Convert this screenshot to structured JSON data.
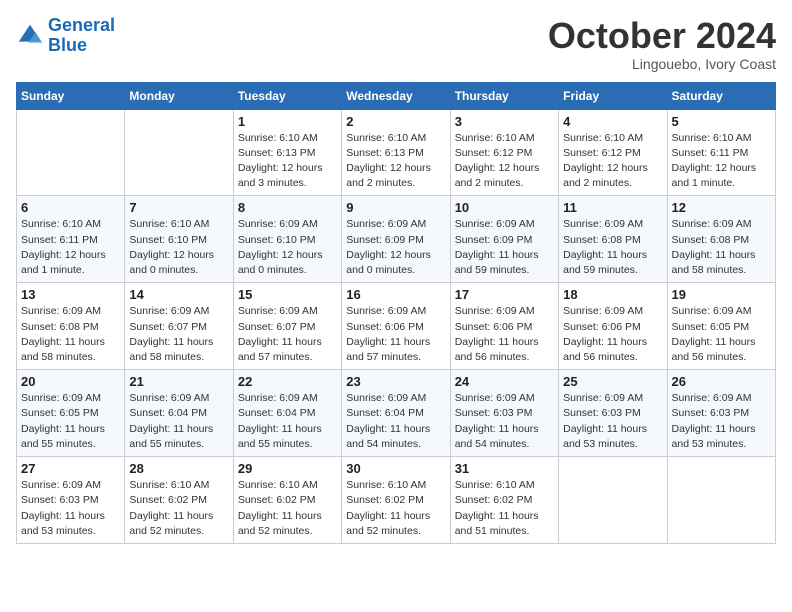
{
  "header": {
    "logo_line1": "General",
    "logo_line2": "Blue",
    "month": "October 2024",
    "location": "Lingouebo, Ivory Coast"
  },
  "weekdays": [
    "Sunday",
    "Monday",
    "Tuesday",
    "Wednesday",
    "Thursday",
    "Friday",
    "Saturday"
  ],
  "weeks": [
    [
      {
        "day": "",
        "info": ""
      },
      {
        "day": "",
        "info": ""
      },
      {
        "day": "1",
        "info": "Sunrise: 6:10 AM\nSunset: 6:13 PM\nDaylight: 12 hours and 3 minutes."
      },
      {
        "day": "2",
        "info": "Sunrise: 6:10 AM\nSunset: 6:13 PM\nDaylight: 12 hours and 2 minutes."
      },
      {
        "day": "3",
        "info": "Sunrise: 6:10 AM\nSunset: 6:12 PM\nDaylight: 12 hours and 2 minutes."
      },
      {
        "day": "4",
        "info": "Sunrise: 6:10 AM\nSunset: 6:12 PM\nDaylight: 12 hours and 2 minutes."
      },
      {
        "day": "5",
        "info": "Sunrise: 6:10 AM\nSunset: 6:11 PM\nDaylight: 12 hours and 1 minute."
      }
    ],
    [
      {
        "day": "6",
        "info": "Sunrise: 6:10 AM\nSunset: 6:11 PM\nDaylight: 12 hours and 1 minute."
      },
      {
        "day": "7",
        "info": "Sunrise: 6:10 AM\nSunset: 6:10 PM\nDaylight: 12 hours and 0 minutes."
      },
      {
        "day": "8",
        "info": "Sunrise: 6:09 AM\nSunset: 6:10 PM\nDaylight: 12 hours and 0 minutes."
      },
      {
        "day": "9",
        "info": "Sunrise: 6:09 AM\nSunset: 6:09 PM\nDaylight: 12 hours and 0 minutes."
      },
      {
        "day": "10",
        "info": "Sunrise: 6:09 AM\nSunset: 6:09 PM\nDaylight: 11 hours and 59 minutes."
      },
      {
        "day": "11",
        "info": "Sunrise: 6:09 AM\nSunset: 6:08 PM\nDaylight: 11 hours and 59 minutes."
      },
      {
        "day": "12",
        "info": "Sunrise: 6:09 AM\nSunset: 6:08 PM\nDaylight: 11 hours and 58 minutes."
      }
    ],
    [
      {
        "day": "13",
        "info": "Sunrise: 6:09 AM\nSunset: 6:08 PM\nDaylight: 11 hours and 58 minutes."
      },
      {
        "day": "14",
        "info": "Sunrise: 6:09 AM\nSunset: 6:07 PM\nDaylight: 11 hours and 58 minutes."
      },
      {
        "day": "15",
        "info": "Sunrise: 6:09 AM\nSunset: 6:07 PM\nDaylight: 11 hours and 57 minutes."
      },
      {
        "day": "16",
        "info": "Sunrise: 6:09 AM\nSunset: 6:06 PM\nDaylight: 11 hours and 57 minutes."
      },
      {
        "day": "17",
        "info": "Sunrise: 6:09 AM\nSunset: 6:06 PM\nDaylight: 11 hours and 56 minutes."
      },
      {
        "day": "18",
        "info": "Sunrise: 6:09 AM\nSunset: 6:06 PM\nDaylight: 11 hours and 56 minutes."
      },
      {
        "day": "19",
        "info": "Sunrise: 6:09 AM\nSunset: 6:05 PM\nDaylight: 11 hours and 56 minutes."
      }
    ],
    [
      {
        "day": "20",
        "info": "Sunrise: 6:09 AM\nSunset: 6:05 PM\nDaylight: 11 hours and 55 minutes."
      },
      {
        "day": "21",
        "info": "Sunrise: 6:09 AM\nSunset: 6:04 PM\nDaylight: 11 hours and 55 minutes."
      },
      {
        "day": "22",
        "info": "Sunrise: 6:09 AM\nSunset: 6:04 PM\nDaylight: 11 hours and 55 minutes."
      },
      {
        "day": "23",
        "info": "Sunrise: 6:09 AM\nSunset: 6:04 PM\nDaylight: 11 hours and 54 minutes."
      },
      {
        "day": "24",
        "info": "Sunrise: 6:09 AM\nSunset: 6:03 PM\nDaylight: 11 hours and 54 minutes."
      },
      {
        "day": "25",
        "info": "Sunrise: 6:09 AM\nSunset: 6:03 PM\nDaylight: 11 hours and 53 minutes."
      },
      {
        "day": "26",
        "info": "Sunrise: 6:09 AM\nSunset: 6:03 PM\nDaylight: 11 hours and 53 minutes."
      }
    ],
    [
      {
        "day": "27",
        "info": "Sunrise: 6:09 AM\nSunset: 6:03 PM\nDaylight: 11 hours and 53 minutes."
      },
      {
        "day": "28",
        "info": "Sunrise: 6:10 AM\nSunset: 6:02 PM\nDaylight: 11 hours and 52 minutes."
      },
      {
        "day": "29",
        "info": "Sunrise: 6:10 AM\nSunset: 6:02 PM\nDaylight: 11 hours and 52 minutes."
      },
      {
        "day": "30",
        "info": "Sunrise: 6:10 AM\nSunset: 6:02 PM\nDaylight: 11 hours and 52 minutes."
      },
      {
        "day": "31",
        "info": "Sunrise: 6:10 AM\nSunset: 6:02 PM\nDaylight: 11 hours and 51 minutes."
      },
      {
        "day": "",
        "info": ""
      },
      {
        "day": "",
        "info": ""
      }
    ]
  ]
}
